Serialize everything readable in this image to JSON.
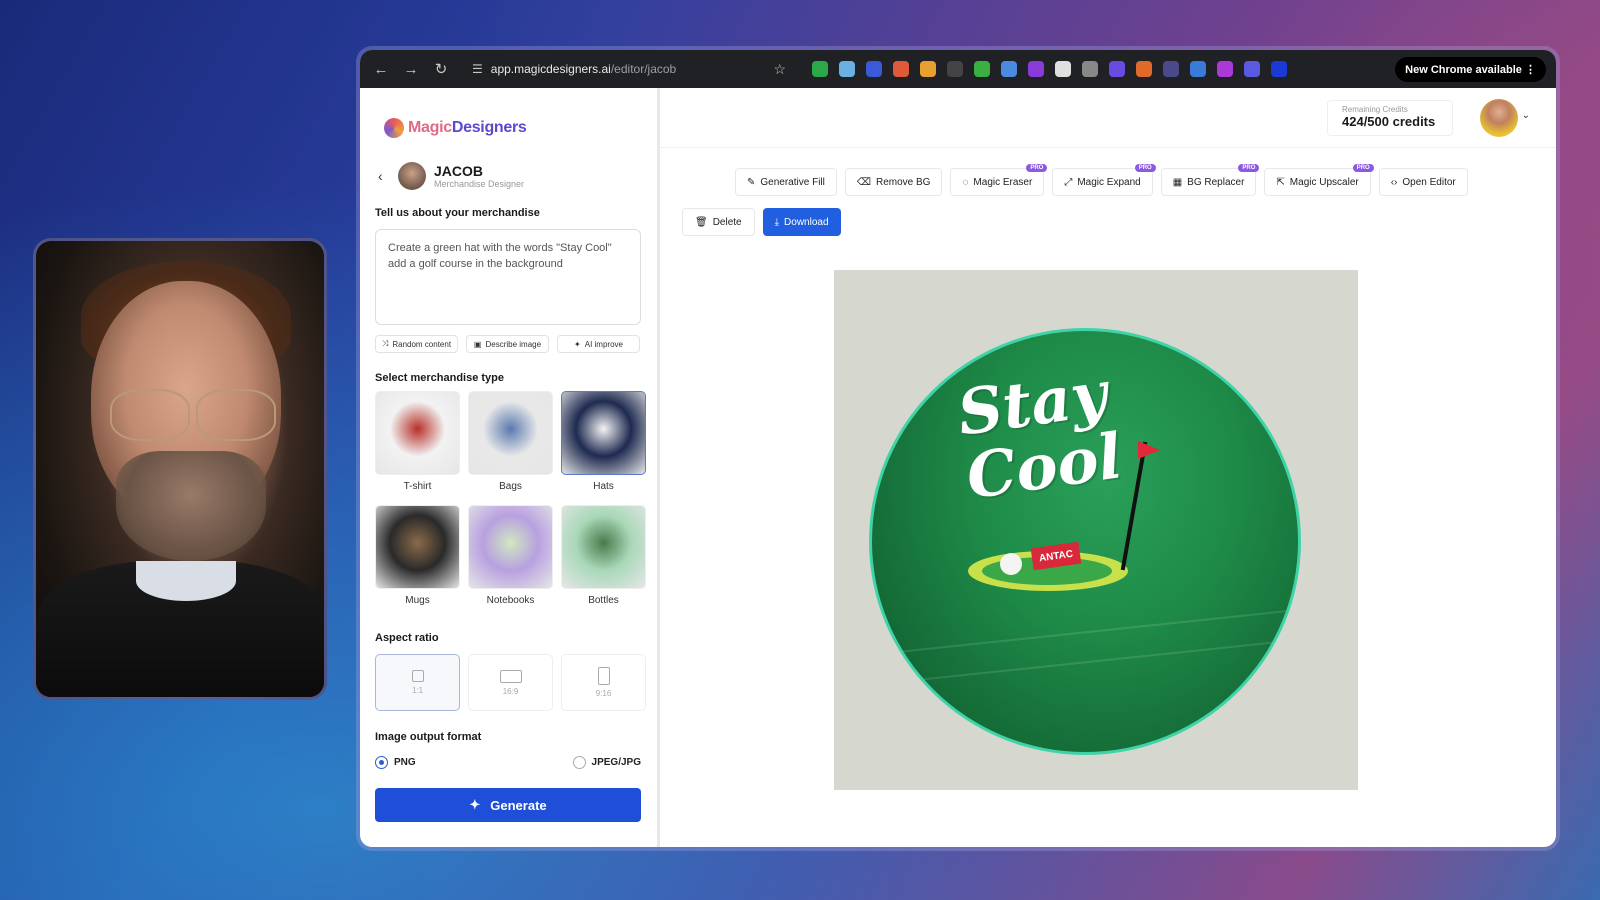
{
  "browser": {
    "url_host": "app.magicdesigners.ai",
    "url_path": "/editor/jacob",
    "update_label": "New Chrome available",
    "extension_colors": [
      "#2ca84a",
      "#6ab0e0",
      "#3a5ad8",
      "#e05a3a",
      "#e8a030",
      "#444",
      "#3ab040",
      "#4a8ae0",
      "#8a3ad8",
      "#e0e0e0",
      "#888",
      "#6a4ae0",
      "#e06a2a",
      "#4a4a8a",
      "#3a7ad8",
      "#aa3ad8",
      "#5a5ae0",
      "#1a3ad8"
    ]
  },
  "brand": {
    "name_a": "Magic",
    "name_b": "Designers"
  },
  "persona": {
    "name": "JACOB",
    "role": "Merchandise Designer"
  },
  "form": {
    "about_label": "Tell us about your merchandise",
    "prompt_text": "Create a green hat with the words \"Stay Cool\" add a golf course in the background",
    "chips": [
      {
        "label": "Random content",
        "icon": "shuffle-icon"
      },
      {
        "label": "Describe image",
        "icon": "image-icon"
      },
      {
        "label": "AI improve",
        "icon": "sparkle-icon"
      }
    ],
    "type_label": "Select merchandise type",
    "types": [
      {
        "label": "T-shirt",
        "selected": false,
        "colors": [
          "#f2f2f2",
          "#b8302a"
        ]
      },
      {
        "label": "Bags",
        "selected": false,
        "colors": [
          "#e8e8e8",
          "#5a7ab0"
        ]
      },
      {
        "label": "Hats",
        "selected": true,
        "colors": [
          "#1e2a50",
          "#f4f4f4"
        ]
      },
      {
        "label": "Mugs",
        "selected": false,
        "colors": [
          "#2a2a2a",
          "#8a6a4a"
        ]
      },
      {
        "label": "Notebooks",
        "selected": false,
        "colors": [
          "#b8a0e0",
          "#d0e8c0"
        ]
      },
      {
        "label": "Bottles",
        "selected": false,
        "colors": [
          "#a8d8b8",
          "#4a7a4a"
        ]
      }
    ],
    "aspect_label": "Aspect ratio",
    "aspects": [
      {
        "label": "1:1",
        "selected": true
      },
      {
        "label": "16:9",
        "selected": false
      },
      {
        "label": "9:16",
        "selected": false
      }
    ],
    "format_label": "Image output format",
    "format_png": "PNG",
    "format_jpg": "JPEG/JPG",
    "format_selected": "PNG",
    "generate_label": "Generate"
  },
  "credits": {
    "label": "Remaining Credits",
    "value": "424/500 credits"
  },
  "toolbar": [
    {
      "label": "Generative Fill",
      "pro": false,
      "icon": "wand-icon"
    },
    {
      "label": "Remove BG",
      "pro": false,
      "icon": "remove-bg-icon"
    },
    {
      "label": "Magic Eraser",
      "pro": true,
      "icon": "eraser-icon"
    },
    {
      "label": "Magic Expand",
      "pro": true,
      "icon": "expand-icon"
    },
    {
      "label": "BG Replacer",
      "pro": true,
      "icon": "replace-icon"
    },
    {
      "label": "Magic Upscaler",
      "pro": true,
      "icon": "upscale-icon"
    },
    {
      "label": "Open Editor",
      "pro": false,
      "icon": "code-icon"
    }
  ],
  "pro_badge": "PRO",
  "actions": {
    "delete": "Delete",
    "download": "Download"
  },
  "artwork": {
    "line1": "Stay",
    "line2": "Cool",
    "badge": "ANTAC"
  }
}
